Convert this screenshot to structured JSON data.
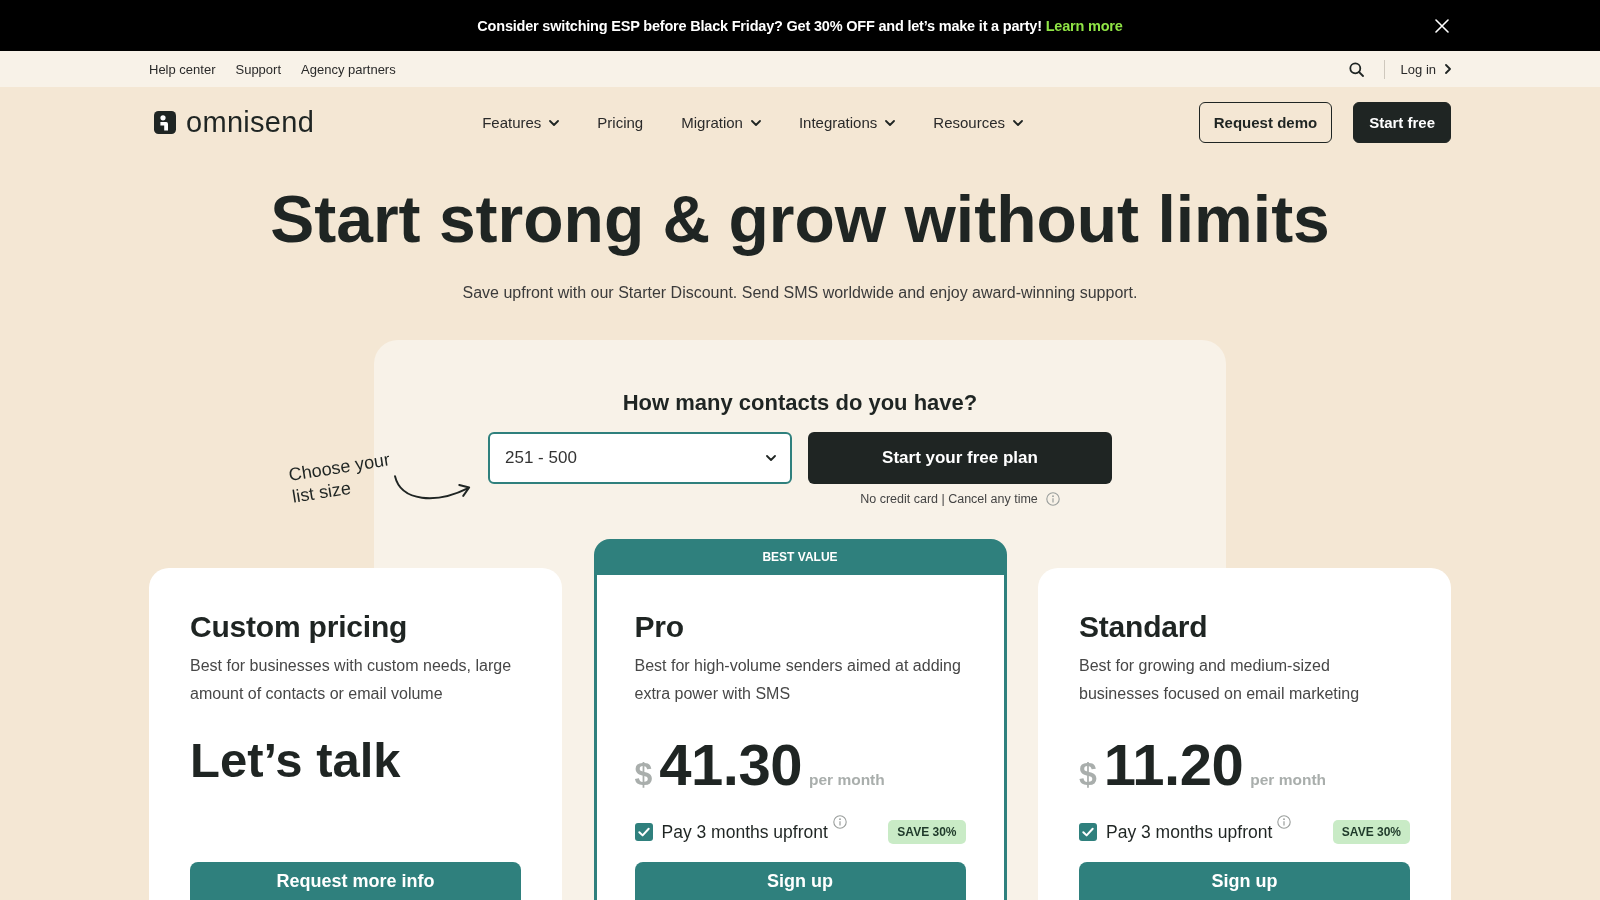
{
  "announcement": {
    "text": "Consider switching ESP before Black Friday? Get 30% OFF and let’s make it a party!",
    "link": "Learn more"
  },
  "utility_nav": {
    "links": [
      "Help center",
      "Support",
      "Agency partners"
    ],
    "login": "Log in"
  },
  "header": {
    "logo": "omnisend",
    "menu": [
      {
        "label": "Features",
        "dropdown": true
      },
      {
        "label": "Pricing",
        "dropdown": false
      },
      {
        "label": "Migration",
        "dropdown": true
      },
      {
        "label": "Integrations",
        "dropdown": true
      },
      {
        "label": "Resources",
        "dropdown": true
      }
    ],
    "buttons": [
      {
        "label": "Request demo",
        "kind": "outline"
      },
      {
        "label": "Start free",
        "kind": "solid"
      }
    ]
  },
  "hero": {
    "title": "Start strong & grow without limits",
    "subtitle": "Save upfront with our Starter Discount. Send SMS worldwide and enjoy award-winning support."
  },
  "contacts_picker": {
    "question": "How many contacts do you have?",
    "annotation": "Choose your list size",
    "select": {
      "value": "251 - 500"
    },
    "button": "Start your free plan",
    "note": "No credit card | Cancel any time"
  },
  "plans": [
    {
      "kind": "custom",
      "name": "Custom pricing",
      "description": "Best for businesses with custom needs, large\namount of contacts or email volume",
      "price_text": "Let’s talk",
      "button": "Request more info"
    },
    {
      "kind": "priced",
      "badge": "BEST VALUE",
      "name": "Pro",
      "description": "Best for high-volume senders aimed at adding\nextra power with SMS",
      "currency": "$",
      "price": "41.30",
      "period": "per month",
      "upfront": {
        "label": "Pay 3 months upfront",
        "checked": true
      },
      "discount": "SAVE 30%",
      "button": "Sign up"
    },
    {
      "kind": "priced",
      "name": "Standard",
      "description": "Best for growing and medium-sized\nbusinesses focused on email marketing",
      "currency": "$",
      "price": "11.20",
      "period": "per month",
      "upfront": {
        "label": "Pay 3 months upfront",
        "checked": true
      },
      "discount": "SAVE 30%",
      "button": "Sign up"
    }
  ]
}
